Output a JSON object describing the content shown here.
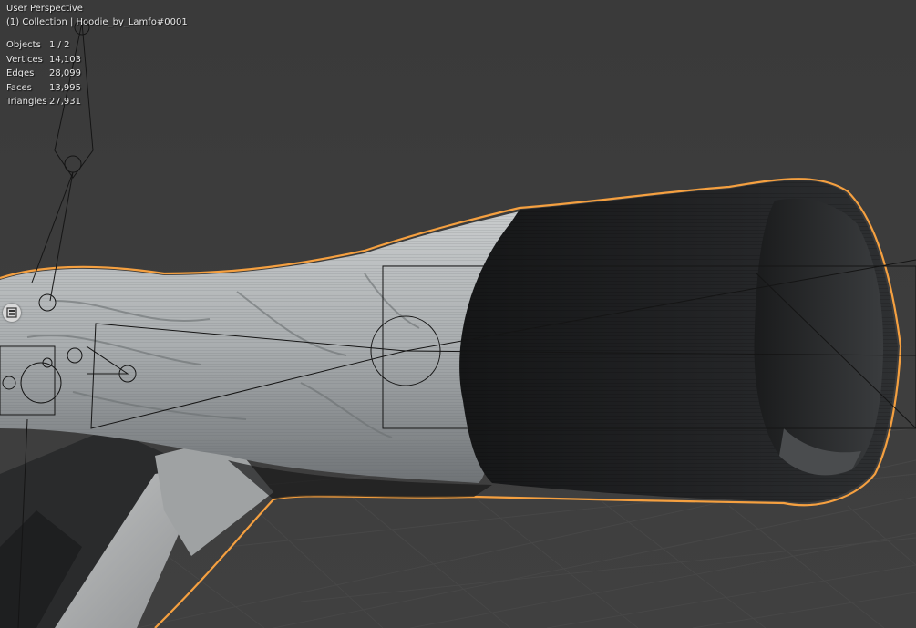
{
  "viewport": {
    "perspective_label": "User Perspective",
    "collection_label": "(1) Collection | Hoodie_by_Lamfo#0001"
  },
  "stats": [
    {
      "label": "Objects",
      "value": "1 / 2"
    },
    {
      "label": "Vertices",
      "value": "14,103"
    },
    {
      "label": "Edges",
      "value": "28,099"
    },
    {
      "label": "Faces",
      "value": "13,995"
    },
    {
      "label": "Triangles",
      "value": "27,931"
    }
  ],
  "colors": {
    "background": "#3c3c3c",
    "grid_line": "#4a4a4a",
    "selection_outline": "#f5a040",
    "fabric_light": "#b8bbbc",
    "fabric_dark": "#1c1d1e",
    "armature_line": "#151515"
  },
  "icons": {
    "side_widget": "image-icon"
  }
}
